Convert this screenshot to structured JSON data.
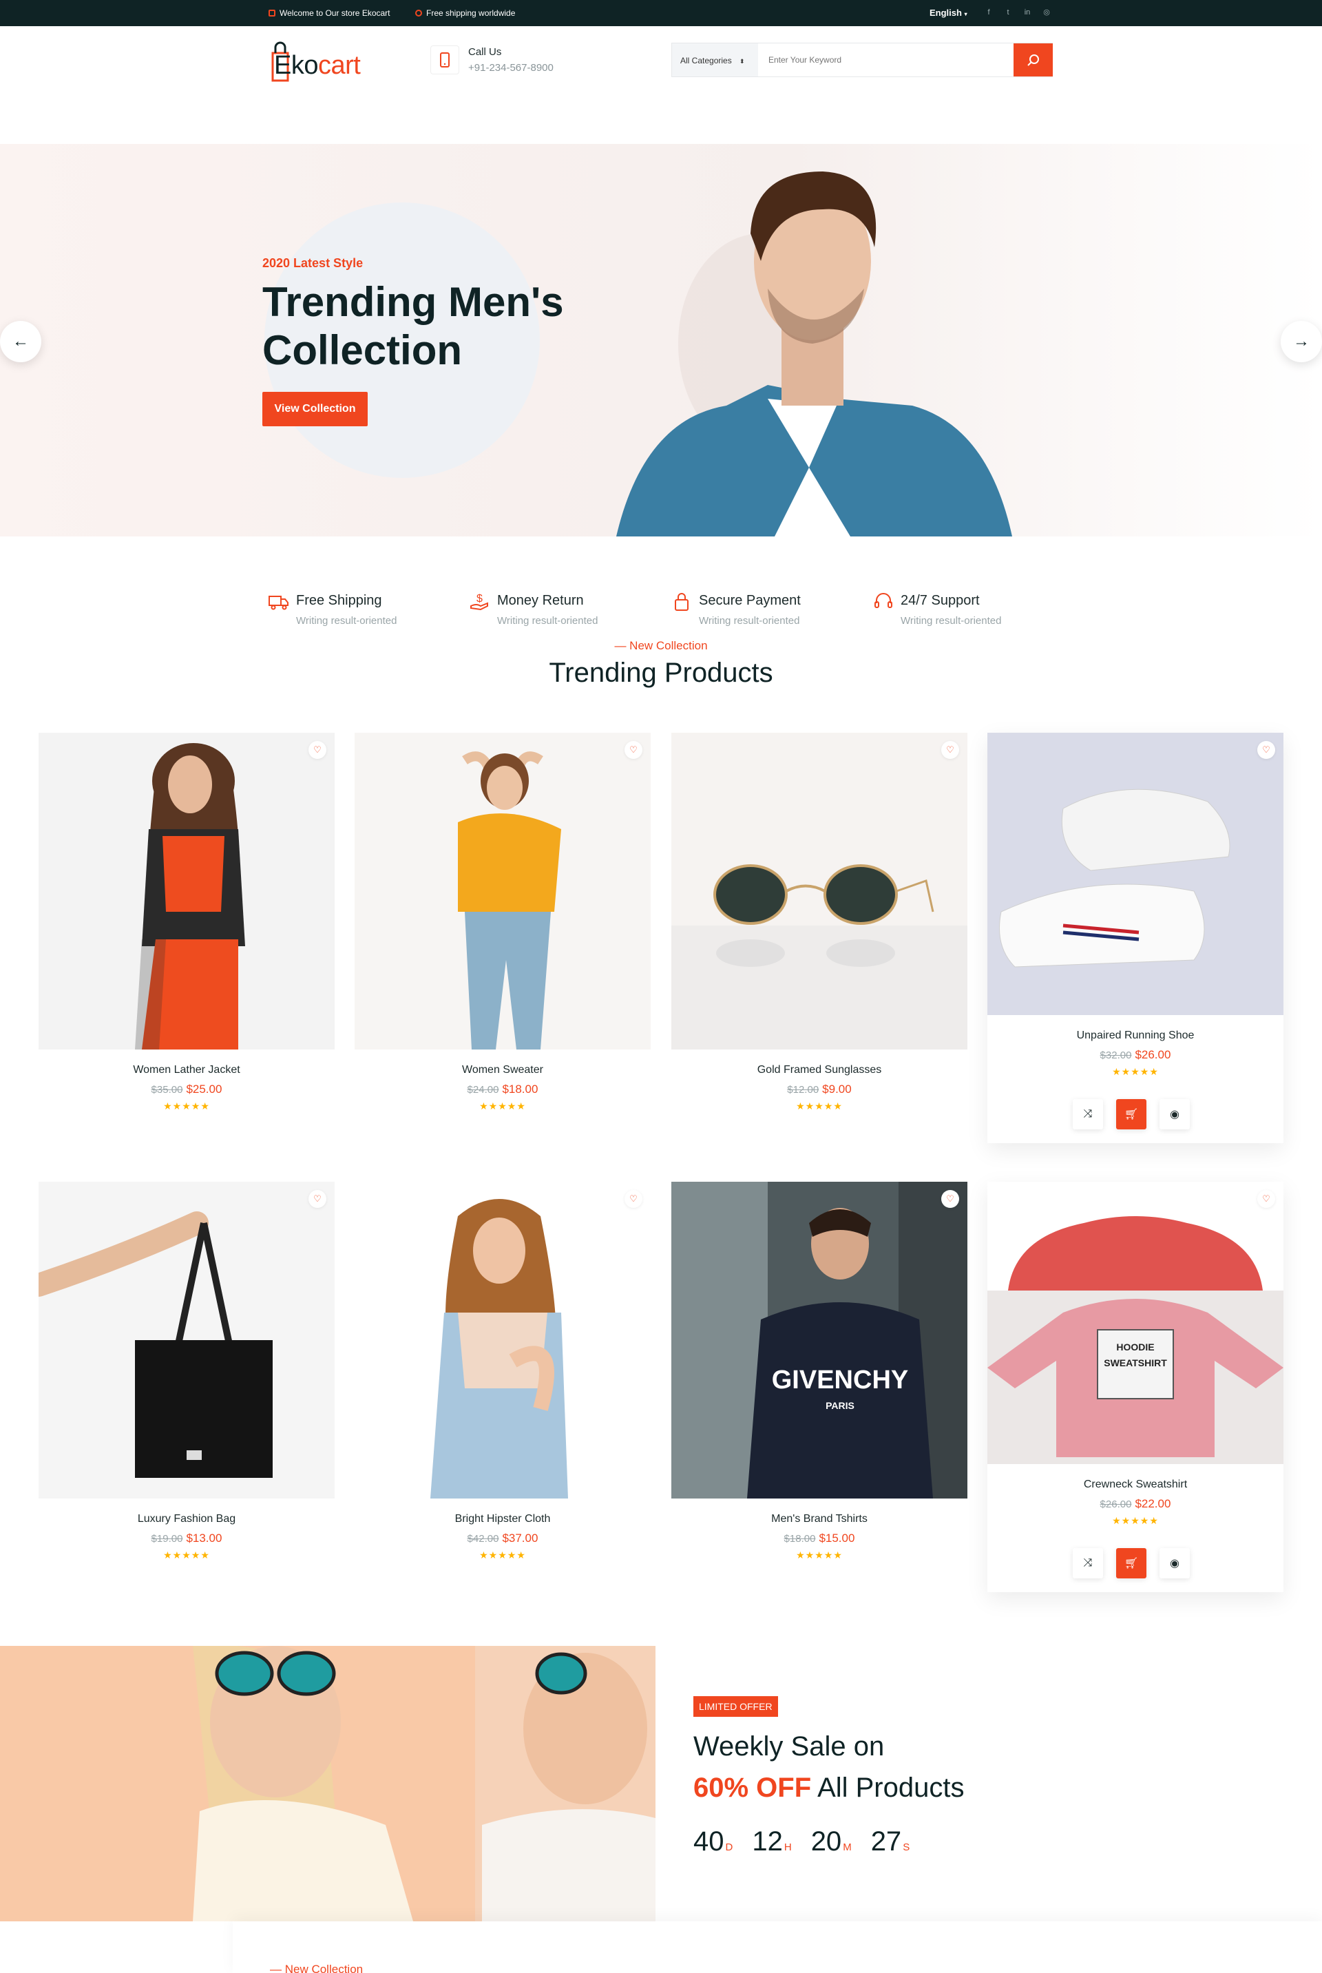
{
  "topbar": {
    "welcome": "Welcome to Our store Ekocart",
    "shipping": "Free shipping worldwide",
    "language": "English",
    "social": [
      "facebook-icon",
      "twitter-icon",
      "linkedin-icon",
      "instagram-icon"
    ]
  },
  "header": {
    "logo_prefix": "Eko",
    "logo_suffix": "cart",
    "call_label": "Call Us",
    "call_number": "+91-234-567-8900",
    "category_select": "All Categories",
    "search_placeholder": "Enter Your Keyword"
  },
  "hero": {
    "subtitle": "2020 Latest Style",
    "title": "Trending Men's Collection",
    "button": "View Collection"
  },
  "features": [
    {
      "title": "Free Shipping",
      "sub": "Writing result-oriented",
      "icon": "truck-icon"
    },
    {
      "title": "Money Return",
      "sub": "Writing result-oriented",
      "icon": "money-icon"
    },
    {
      "title": "Secure Payment",
      "sub": "Writing result-oriented",
      "icon": "lock-icon"
    },
    {
      "title": "24/7 Support",
      "sub": "Writing result-oriented",
      "icon": "headset-icon"
    }
  ],
  "section": {
    "kicker": "— New Collection",
    "title": "Trending Products"
  },
  "products": [
    {
      "name": "Women Lather Jacket",
      "old": "$35.00",
      "price": "$25.00",
      "rating": 5
    },
    {
      "name": "Women Sweater",
      "old": "$24.00",
      "price": "$18.00",
      "rating": 5
    },
    {
      "name": "Gold Framed Sunglasses",
      "old": "$12.00",
      "price": "$9.00",
      "rating": 5
    },
    {
      "name": "Unpaired Running Shoe",
      "old": "$32.00",
      "price": "$26.00",
      "rating": 5
    },
    {
      "name": "Luxury Fashion Bag",
      "old": "$19.00",
      "price": "$13.00",
      "rating": 5
    },
    {
      "name": "Bright Hipster Cloth",
      "old": "$42.00",
      "price": "$37.00",
      "rating": 5
    },
    {
      "name": "Men's Brand Tshirts",
      "old": "$18.00",
      "price": "$15.00",
      "rating": 5
    },
    {
      "name": "Crewneck Sweatshirt",
      "old": "$26.00",
      "price": "$22.00",
      "rating": 5
    }
  ],
  "sale": {
    "badge": "LIMITED OFFER",
    "line1": "Weekly Sale on",
    "highlight": "60% OFF",
    "line2_rest": " All Products",
    "countdown": [
      {
        "value": "40",
        "unit": "D"
      },
      {
        "value": "12",
        "unit": "H"
      },
      {
        "value": "20",
        "unit": "M"
      },
      {
        "value": "27",
        "unit": "S"
      }
    ]
  },
  "next_section": {
    "kicker": "— New Collection"
  },
  "colors": {
    "accent": "#f0461f",
    "dark": "#0f2325",
    "star": "#ffb400"
  }
}
